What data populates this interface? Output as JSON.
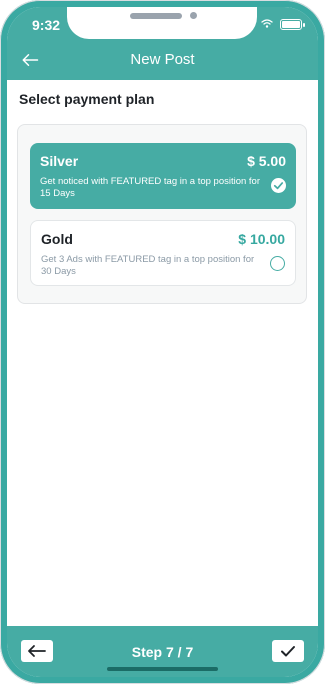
{
  "status_bar": {
    "time": "9:32"
  },
  "nav": {
    "title": "New Post"
  },
  "heading": "Select payment plan",
  "plans": [
    {
      "name": "Silver",
      "price": "$ 5.00",
      "description": "Get noticed with FEATURED tag in a top position for 15 Days",
      "selected": true
    },
    {
      "name": "Gold",
      "price": "$ 10.00",
      "description": "Get 3 Ads with FEATURED tag in a top position for 30 Days",
      "selected": false
    }
  ],
  "footer": {
    "step": "Step 7 / 7"
  },
  "colors": {
    "accent": "#46aca4",
    "gold_price": "#36a8a0",
    "text_dark": "#1f2328",
    "muted": "#8b9aa6"
  },
  "icons": [
    "back-arrow-icon",
    "wifi-icon",
    "battery-icon",
    "checkmark-icon"
  ]
}
